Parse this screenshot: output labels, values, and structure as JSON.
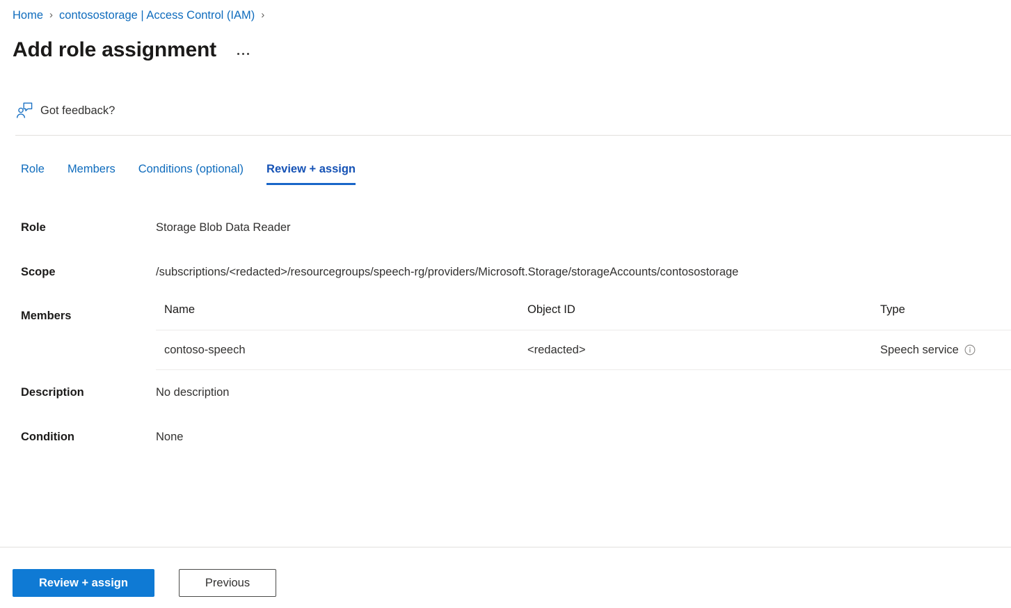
{
  "breadcrumb": {
    "items": [
      {
        "label": "Home"
      },
      {
        "label": "contosostorage | Access Control (IAM)"
      }
    ],
    "separator": "›"
  },
  "header": {
    "title": "Add role assignment",
    "more_actions_label": "···"
  },
  "feedback": {
    "label": "Got feedback?",
    "icon": "feedback-person-icon"
  },
  "tabs": [
    {
      "label": "Role",
      "active": false
    },
    {
      "label": "Members",
      "active": false
    },
    {
      "label": "Conditions (optional)",
      "active": false
    },
    {
      "label": "Review + assign",
      "active": true
    }
  ],
  "details": {
    "role": {
      "label": "Role",
      "value": "Storage Blob Data Reader"
    },
    "scope": {
      "label": "Scope",
      "value": "/subscriptions/<redacted>/resourcegroups/speech-rg/providers/Microsoft.Storage/storageAccounts/contosostorage"
    },
    "members": {
      "label": "Members",
      "columns": [
        "Name",
        "Object ID",
        "Type"
      ],
      "rows": [
        {
          "name": "contoso-speech",
          "object_id": "<redacted>",
          "type": "Speech service",
          "type_info_icon": "info-icon"
        }
      ]
    },
    "description": {
      "label": "Description",
      "value": "No description"
    },
    "condition": {
      "label": "Condition",
      "value": "None"
    }
  },
  "footer": {
    "primary_button": "Review + assign",
    "secondary_button": "Previous"
  },
  "colors": {
    "accent": "#0f7ad4",
    "link": "#0f6cbd",
    "active_tab": "#1552b5",
    "tab_underline": "#1966c8",
    "text": "#323130",
    "border": "#e1dfdd"
  }
}
